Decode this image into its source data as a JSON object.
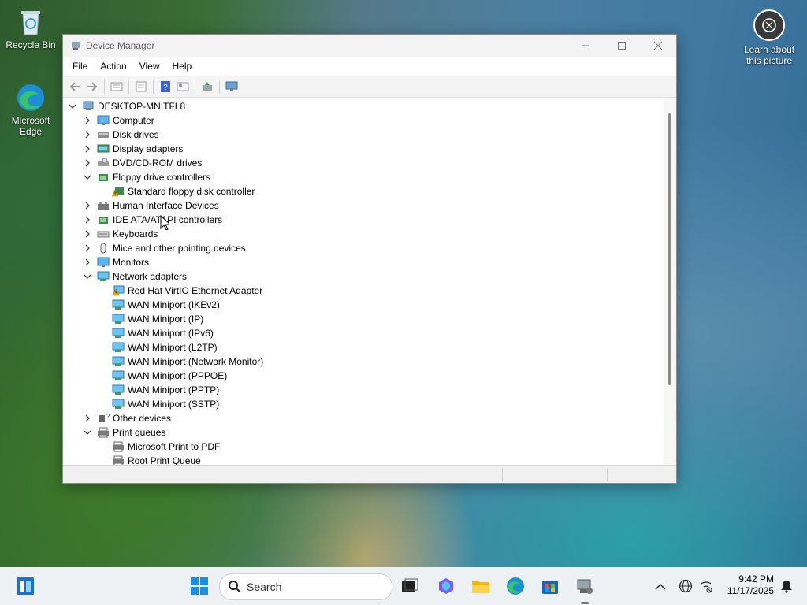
{
  "desktop": {
    "icons": [
      {
        "label": "Recycle Bin",
        "icon": "recycle-bin-icon"
      },
      {
        "label": "Microsoft Edge",
        "icon": "edge-icon"
      }
    ],
    "learn_line1": "Learn about",
    "learn_line2": "this picture"
  },
  "window": {
    "title": "Device Manager",
    "menu": [
      "File",
      "Action",
      "View",
      "Help"
    ],
    "toolbar": [
      "back-icon",
      "forward-icon",
      "properties-icon",
      "show-hide-icon",
      "help-icon",
      "view-icon",
      "update-driver-icon",
      "scan-hardware-icon"
    ],
    "tree": [
      {
        "label": "DESKTOP-MNITFL8",
        "level": 0,
        "state": "expanded",
        "icon": "computer-icon"
      },
      {
        "label": "Computer",
        "level": 1,
        "state": "collapsed",
        "icon": "monitor-icon"
      },
      {
        "label": "Disk drives",
        "level": 1,
        "state": "collapsed",
        "icon": "disk-icon"
      },
      {
        "label": "Display adapters",
        "level": 1,
        "state": "collapsed",
        "icon": "display-adapter-icon"
      },
      {
        "label": "DVD/CD-ROM drives",
        "level": 1,
        "state": "collapsed",
        "icon": "dvd-icon"
      },
      {
        "label": "Floppy drive controllers",
        "level": 1,
        "state": "expanded",
        "icon": "controller-icon"
      },
      {
        "label": "Standard floppy disk controller",
        "level": 2,
        "state": "leaf",
        "icon": "warning-controller-icon"
      },
      {
        "label": "Human Interface Devices",
        "level": 1,
        "state": "collapsed",
        "icon": "hid-icon"
      },
      {
        "label": "IDE ATA/ATAPI controllers",
        "level": 1,
        "state": "collapsed",
        "icon": "controller-icon"
      },
      {
        "label": "Keyboards",
        "level": 1,
        "state": "collapsed",
        "icon": "keyboard-icon"
      },
      {
        "label": "Mice and other pointing devices",
        "level": 1,
        "state": "collapsed",
        "icon": "mouse-icon"
      },
      {
        "label": "Monitors",
        "level": 1,
        "state": "collapsed",
        "icon": "monitor-icon"
      },
      {
        "label": "Network adapters",
        "level": 1,
        "state": "expanded",
        "icon": "network-icon"
      },
      {
        "label": "Red Hat VirtIO Ethernet Adapter",
        "level": 2,
        "state": "leaf",
        "icon": "warning-network-icon"
      },
      {
        "label": "WAN Miniport (IKEv2)",
        "level": 2,
        "state": "leaf",
        "icon": "network-icon"
      },
      {
        "label": "WAN Miniport (IP)",
        "level": 2,
        "state": "leaf",
        "icon": "network-icon"
      },
      {
        "label": "WAN Miniport (IPv6)",
        "level": 2,
        "state": "leaf",
        "icon": "network-icon"
      },
      {
        "label": "WAN Miniport (L2TP)",
        "level": 2,
        "state": "leaf",
        "icon": "network-icon"
      },
      {
        "label": "WAN Miniport (Network Monitor)",
        "level": 2,
        "state": "leaf",
        "icon": "network-icon"
      },
      {
        "label": "WAN Miniport (PPPOE)",
        "level": 2,
        "state": "leaf",
        "icon": "network-icon"
      },
      {
        "label": "WAN Miniport (PPTP)",
        "level": 2,
        "state": "leaf",
        "icon": "network-icon"
      },
      {
        "label": "WAN Miniport (SSTP)",
        "level": 2,
        "state": "leaf",
        "icon": "network-icon"
      },
      {
        "label": "Other devices",
        "level": 1,
        "state": "collapsed",
        "icon": "unknown-device-icon"
      },
      {
        "label": "Print queues",
        "level": 1,
        "state": "expanded",
        "icon": "printer-icon"
      },
      {
        "label": "Microsoft Print to PDF",
        "level": 2,
        "state": "leaf",
        "icon": "printer-icon"
      },
      {
        "label": "Root Print Queue",
        "level": 2,
        "state": "leaf",
        "icon": "printer-icon"
      }
    ]
  },
  "taskbar": {
    "search_placeholder": "Search",
    "time": "9:42 PM",
    "date": "11/17/2025"
  },
  "colors": {
    "warning": "#f2b600",
    "accent": "#0067c0"
  }
}
